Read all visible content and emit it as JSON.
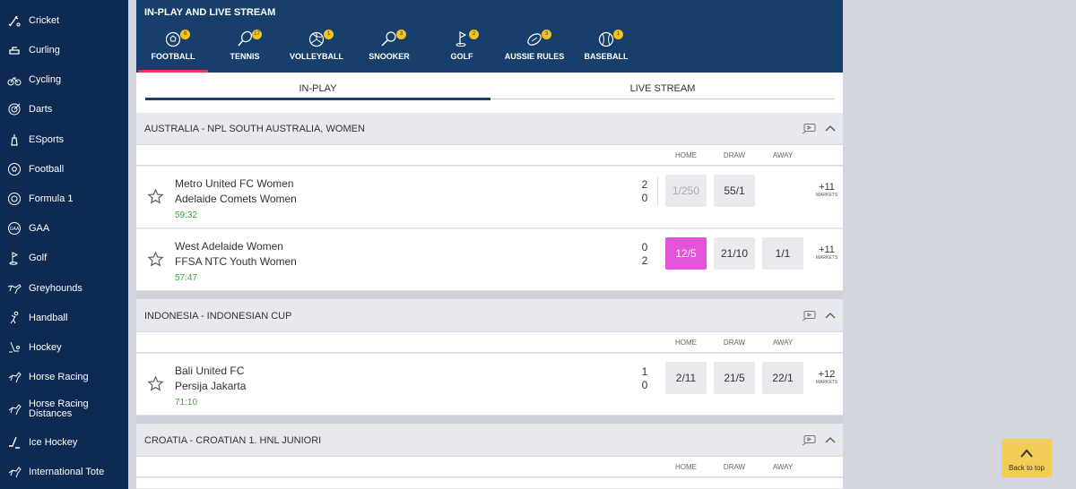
{
  "sidebar": {
    "items": [
      {
        "label": "Cricket",
        "icon": "cricket-icon"
      },
      {
        "label": "Curling",
        "icon": "curling-icon"
      },
      {
        "label": "Cycling",
        "icon": "cycling-icon"
      },
      {
        "label": "Darts",
        "icon": "darts-icon"
      },
      {
        "label": "ESports",
        "icon": "esports-icon"
      },
      {
        "label": "Football",
        "icon": "football-icon"
      },
      {
        "label": "Formula 1",
        "icon": "formula1-icon"
      },
      {
        "label": "GAA",
        "icon": "gaa-icon"
      },
      {
        "label": "Golf",
        "icon": "golf-icon"
      },
      {
        "label": "Greyhounds",
        "icon": "greyhound-icon"
      },
      {
        "label": "Handball",
        "icon": "handball-icon"
      },
      {
        "label": "Hockey",
        "icon": "hockey-icon"
      },
      {
        "label": "Horse Racing",
        "icon": "horse-racing-icon"
      },
      {
        "label": "Horse Racing",
        "label2": "Distances",
        "icon": "horse-racing-distances-icon"
      },
      {
        "label": "Ice Hockey",
        "icon": "ice-hockey-icon"
      },
      {
        "label": "International Tote",
        "icon": "tote-icon"
      }
    ]
  },
  "header": {
    "title": "IN-PLAY AND LIVE STREAM",
    "sports": [
      {
        "label": "FOOTBALL",
        "count": "8",
        "icon": "football-icon",
        "active": true
      },
      {
        "label": "TENNIS",
        "count": "17",
        "icon": "tennis-icon"
      },
      {
        "label": "VOLLEYBALL",
        "count": "1",
        "icon": "volleyball-icon"
      },
      {
        "label": "SNOOKER",
        "count": "3",
        "icon": "snooker-icon"
      },
      {
        "label": "GOLF",
        "count": "2",
        "icon": "golf-icon"
      },
      {
        "label": "AUSSIE RULES",
        "count": "3",
        "icon": "aussie-rules-icon"
      },
      {
        "label": "BASEBALL",
        "count": "1",
        "icon": "baseball-icon"
      }
    ]
  },
  "tabs": {
    "inplay": "IN-PLAY",
    "livestream": "LIVE STREAM",
    "active": "IN-PLAY"
  },
  "columns": {
    "home": "HOME",
    "draw": "DRAW",
    "away": "AWAY"
  },
  "markets_label": "MARKETS",
  "leagues": [
    {
      "name": "AUSTRALIA - NPL SOUTH AUSTRALIA, WOMEN",
      "matches": [
        {
          "home": "Metro United FC Women",
          "away": "Adelaide Comets Women",
          "time": "59:32",
          "score_home": "2",
          "score_away": "0",
          "odds": [
            "1/250",
            "55/1",
            ""
          ],
          "markets": "+11"
        },
        {
          "home": "West Adelaide Women",
          "away": "FFSA NTC Youth Women",
          "time": "57:47",
          "score_home": "0",
          "score_away": "2",
          "odds": [
            "12/5",
            "21/10",
            "1/1"
          ],
          "markets": "+11"
        }
      ]
    },
    {
      "name": "INDONESIA - INDONESIAN CUP",
      "matches": [
        {
          "home": "Bali United FC",
          "away": "Persija Jakarta",
          "time": "71:10",
          "score_home": "1",
          "score_away": "0",
          "odds": [
            "2/11",
            "21/5",
            "22/1"
          ],
          "markets": "+12"
        }
      ]
    },
    {
      "name": "CROATIA - CROATIAN 1. HNL JUNIORI",
      "matches": []
    }
  ],
  "back_to_top": "Back to top",
  "colors": {
    "sidebar_bg": "#0e2a52",
    "header_bg": "#183f6b",
    "highlight_odd": "#e254d9",
    "badge": "#f5c21a",
    "live_time": "#3aa63a"
  }
}
